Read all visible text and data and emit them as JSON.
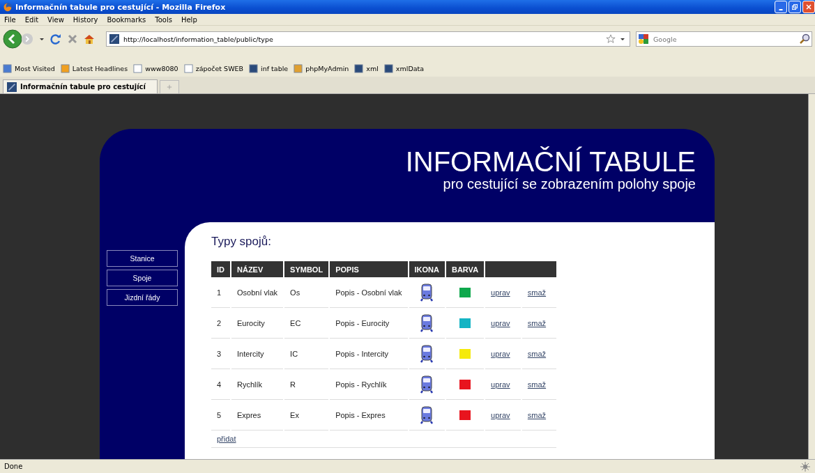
{
  "window": {
    "title": "Informačnín tabule pro cestující - Mozilla Firefox"
  },
  "menu": [
    "File",
    "Edit",
    "View",
    "History",
    "Bookmarks",
    "Tools",
    "Help"
  ],
  "address": {
    "value": "http://localhost/information_table/public/type"
  },
  "search": {
    "placeholder": "Google"
  },
  "bookmarks": [
    {
      "label": "Most Visited",
      "kind": "star"
    },
    {
      "label": "Latest Headlines",
      "kind": "feed"
    },
    {
      "label": "www8080",
      "kind": "page"
    },
    {
      "label": "zápočet SWEB",
      "kind": "page"
    },
    {
      "label": "inf table",
      "kind": "site"
    },
    {
      "label": "phpMyAdmin",
      "kind": "pma"
    },
    {
      "label": "xml",
      "kind": "site"
    },
    {
      "label": "xmlData",
      "kind": "site"
    }
  ],
  "tabs": [
    {
      "label": "Informačnín tabule pro cestující",
      "selected": true
    }
  ],
  "header": {
    "title": "INFORMAČNÍ TABULE",
    "subtitle": "pro cestující se zobrazením polohy spoje"
  },
  "sidebar": {
    "items": [
      "Stanice",
      "Spoje",
      "Jizdní řády"
    ]
  },
  "content": {
    "heading": "Typy spojů:",
    "table": {
      "columns": [
        "ID",
        "NÁZEV",
        "SYMBOL",
        "POPIS",
        "IKONA",
        "BARVA"
      ],
      "rows": [
        {
          "id": "1",
          "name": "Osobní vlak",
          "symbol": "Os",
          "description": "Popis - Osobní vlak",
          "color": "#0ea84c",
          "edit": "uprav",
          "delete": "smaž"
        },
        {
          "id": "2",
          "name": "Eurocity",
          "symbol": "EC",
          "description": "Popis - Eurocity",
          "color": "#14b4c4",
          "edit": "uprav",
          "delete": "smaž"
        },
        {
          "id": "3",
          "name": "Intercity",
          "symbol": "IC",
          "description": "Popis - Intercity",
          "color": "#f5ea0a",
          "edit": "uprav",
          "delete": "smaž"
        },
        {
          "id": "4",
          "name": "Rychlík",
          "symbol": "R",
          "description": "Popis - Rychlík",
          "color": "#e8141e",
          "edit": "uprav",
          "delete": "smaž"
        },
        {
          "id": "5",
          "name": "Expres",
          "symbol": "Ex",
          "description": "Popis - Expres",
          "color": "#e8141e",
          "edit": "uprav",
          "delete": "smaž"
        }
      ],
      "add_link": "přidat"
    }
  },
  "status_bar": {
    "text": "Done"
  }
}
